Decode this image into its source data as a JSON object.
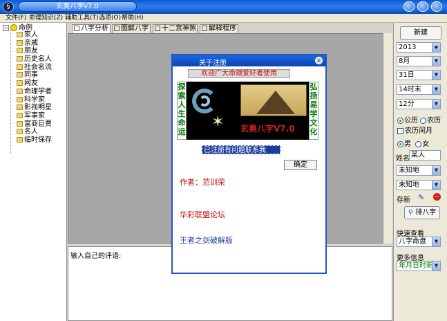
{
  "window": {
    "title": "玄奥八字v7.0"
  },
  "menu": [
    "文件(F)",
    "命理知识(Z)",
    "辅助工具(T)",
    "选项(O)",
    "帮助(H)"
  ],
  "tree": {
    "root": "命例",
    "items": [
      "家人",
      "亲戚",
      "朋友",
      "历史名人",
      "社会名流",
      "同事",
      "网友",
      "命理学者",
      "科学家",
      "影视明星",
      "军事家",
      "富商巨贾",
      "名人",
      "临时保存"
    ]
  },
  "tabs": [
    "八字分析",
    "图解八字",
    "十二宫神煞",
    "解释程序"
  ],
  "comment": {
    "label": "输入自己的评语:"
  },
  "right_panel": {
    "new_button": "新建",
    "year": "2013",
    "month": "8月",
    "day": "31日",
    "hour": "14时末",
    "minute": "12分",
    "calendar_solar": "公历",
    "calendar_lunar": "农历",
    "leap_month": "农历闰月",
    "gender_male": "男",
    "gender_female": "女",
    "name_label": "姓名",
    "name_value": "某人",
    "place1": "未知地",
    "place2": "未知地",
    "save_label": "存新",
    "arrange_button": "排八字",
    "quick_view_label": "快速查看",
    "quick_view_value": "八字命盘",
    "more_info_label": "更多信息",
    "more_info_value": "年月日时新命"
  },
  "dialog": {
    "title": "关于注册",
    "welcome": "欢迎广大命理爱好者使用",
    "left_vertical": "探索人生命运",
    "right_vertical": "弘扬易学文化",
    "banner_text": "玄奥八字V7.0",
    "registered": "已注册有问题联系我",
    "ok_button": "确定",
    "author": "作者：范训荣",
    "forum": "华彩联盟论坛",
    "crack": "王者之剑破解版"
  },
  "colors": {
    "titlebar": "#2f7ef0",
    "dialog_red": "#c01010",
    "dialog_blue": "#1c3d9c",
    "green": "#0a7a0a"
  }
}
